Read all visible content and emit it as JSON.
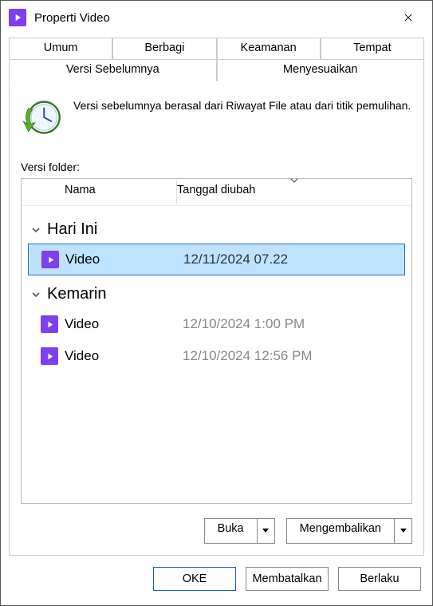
{
  "window": {
    "title": "Properti Video"
  },
  "tabs": {
    "row1": [
      "Umum",
      "Berbagi",
      "Keamanan",
      "Tempat"
    ],
    "row2": [
      "Versi Sebelumnya",
      "Menyesuaikan"
    ],
    "active": "Versi Sebelumnya"
  },
  "description": "Versi sebelumnya berasal dari Riwayat File atau dari titik pemulihan.",
  "folder_versions_label": "Versi folder:",
  "columns": {
    "name": "Nama",
    "date": "Tanggal diubah"
  },
  "groups": [
    {
      "label": "Hari Ini",
      "items": [
        {
          "name": "Video",
          "date": "12/11/2024 07.22",
          "selected": true
        }
      ]
    },
    {
      "label": "Kemarin",
      "items": [
        {
          "name": "Video",
          "date": "12/10/2024 1:00 PM",
          "selected": false
        },
        {
          "name": "Video",
          "date": "12/10/2024 12:56 PM",
          "selected": false
        }
      ]
    }
  ],
  "actions": {
    "open": "Buka",
    "restore": "Mengembalikan"
  },
  "footer": {
    "ok": "OKE",
    "cancel": "Membatalkan",
    "apply": "Berlaku"
  },
  "colors": {
    "accent": "#7e3ff2",
    "selection": "#bde3ff"
  }
}
